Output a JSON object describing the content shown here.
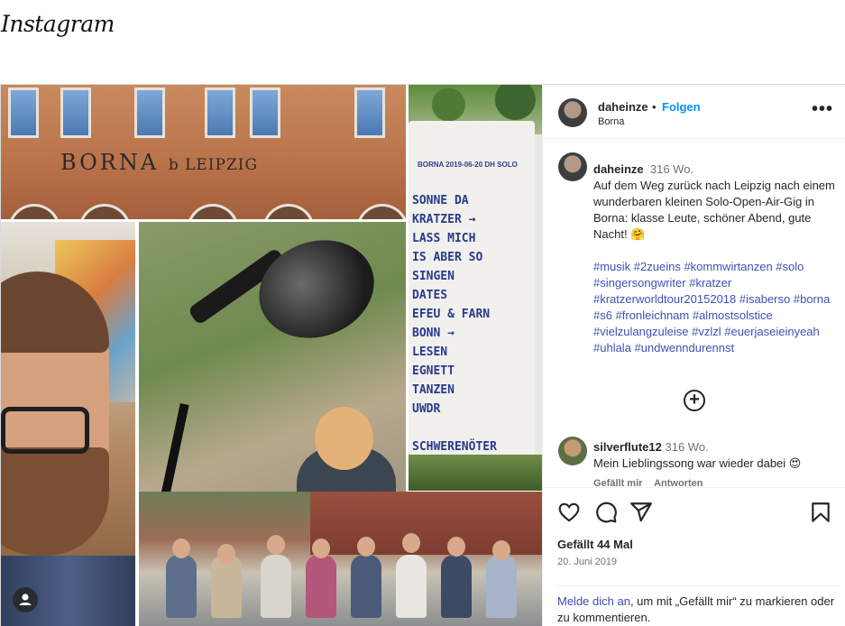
{
  "app": {
    "logo": "Instagram"
  },
  "post_header": {
    "username": "daheinze",
    "separator": "•",
    "follow_label": "Folgen",
    "location": "Borna",
    "more_label": "•••"
  },
  "photo_text": {
    "station_sign": "BORNA",
    "station_sign_small": "b LEIPZIG",
    "setlist_header": "BORNA 2019-06-20 DH SOLO",
    "setlist": [
      "SONNE DA",
      "KRATZER →",
      "LASS MICH",
      "IS ABER SO",
      "SINGEN",
      "DATES",
      "EFEU & FARN",
      "BONN →",
      "LESEN",
      "EGNETT",
      "TANZEN",
      "UWDR",
      "",
      "SCHWERENÖTER"
    ]
  },
  "caption": {
    "username": "daheinze",
    "age": "316 Wo.",
    "text": "Auf dem Weg zurück nach Leipzig nach einem wunderbaren kleinen Solo-Open-Air-Gig in Borna: klasse Leute, schöner Abend, gute Nacht! 🤗",
    "hashtags": "#musik #2zueins #kommwirtanzen #solo #singersongwriter #kratzer #kratzerworldtour20152018 #isaberso #borna #s6 #fronleichnam #almostsolstice #vielzulangzuleise #vzlzl #euerjaseieinyeah #uhlala #undwenndurennst"
  },
  "load_more_icon": "+",
  "comment": {
    "username": "silverflute12",
    "age": "316 Wo.",
    "text": "Mein Lieblingssong war wieder dabei 😍",
    "like_label": "Gefällt mir",
    "reply_label": "Antworten"
  },
  "actions": {
    "likes": "Gefällt 44 Mal",
    "date": "20. Juni 2019",
    "login_link": "Melde dich an",
    "login_rest": ", um mit „Gefällt mir“ zu markieren oder zu kommentieren."
  },
  "colors": {
    "link_blue": "#0095f6",
    "hashtag_blue": "#3b4cb8",
    "muted": "#737373"
  }
}
